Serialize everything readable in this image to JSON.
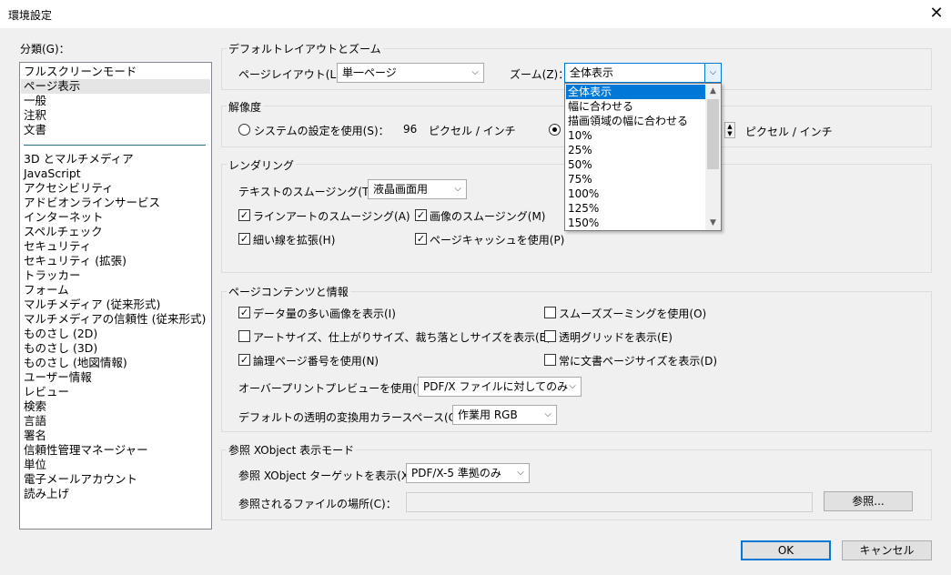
{
  "window": {
    "title": "環境設定",
    "close_glyph": "✕"
  },
  "categories": {
    "label": "分類(G)：",
    "items_top": [
      "フルスクリーンモード",
      "ページ表示",
      "一般",
      "注釈",
      "文書"
    ],
    "items_bottom": [
      "3D とマルチメディア",
      "JavaScript",
      "アクセシビリティ",
      "アドビオンラインサービス",
      "インターネット",
      "スペルチェック",
      "セキュリティ",
      "セキュリティ (拡張)",
      "トラッカー",
      "フォーム",
      "マルチメディア (従来形式)",
      "マルチメディアの信頼性 (従来形式)",
      "ものさし (2D)",
      "ものさし (3D)",
      "ものさし (地図情報)",
      "ユーザー情報",
      "レビュー",
      "検索",
      "言語",
      "署名",
      "信頼性管理マネージャー",
      "単位",
      "電子メールアカウント",
      "読み上げ"
    ],
    "selected": "ページ表示"
  },
  "layout_zoom": {
    "title": "デフォルトレイアウトとズーム",
    "page_layout_label": "ページレイアウト(L)：",
    "page_layout_value": "単一ページ",
    "zoom_label": "ズーム(Z)：",
    "zoom_value": "全体表示"
  },
  "zoom_dropdown": {
    "options": [
      "全体表示",
      "幅に合わせる",
      "描画領域の幅に合わせる",
      "10%",
      "25%",
      "50%",
      "75%",
      "100%",
      "125%",
      "150%"
    ],
    "selected": "全体表示"
  },
  "resolution": {
    "title": "解像度",
    "system_label": "システムの設定を使用(S)：",
    "system_value": "96",
    "unit_1": "ピクセル / インチ",
    "unit_2": "ピクセル / インチ"
  },
  "rendering": {
    "title": "レンダリング",
    "text_smoothing_label": "テキストのスムージング(T)：",
    "text_smoothing_value": "液晶画面用",
    "lineart_smoothing": "ラインアートのスムージング(A)",
    "image_smoothing": "画像のスムージング(M)",
    "enhance_thin_lines": "細い線を拡張(H)",
    "page_cache": "ページキャッシュを使用(P)"
  },
  "page_content": {
    "title": "ページコンテンツと情報",
    "large_images": "データ量の多い画像を表示(I)",
    "smooth_zooming": "スムーズズーミングを使用(O)",
    "art_trim_bleed": "アートサイズ、仕上がりサイズ、裁ち落としサイズを表示(B)",
    "transparency_grid": "透明グリッドを表示(E)",
    "logical_page_numbers": "論理ページ番号を使用(N)",
    "always_doc_page_size": "常に文書ページサイズを表示(D)",
    "overprint_label": "オーバープリントプレビューを使用(W)：",
    "overprint_value": "PDF/X ファイルに対してのみ",
    "transparency_blend_label": "デフォルトの透明の変換用カラースペース(C)：",
    "transparency_blend_value": "作業用 RGB"
  },
  "xobject": {
    "title": "参照 XObject 表示モード",
    "target_label": "参照 XObject ターゲットを表示(X)：",
    "target_value": "PDF/X-5 準拠のみ",
    "location_label": "参照されるファイルの場所(C)：",
    "browse_label": "参照..."
  },
  "footer": {
    "ok_label": "OK",
    "cancel_label": "キャンセル"
  },
  "glyphs": {
    "check": "✓",
    "chevron_down": "⌵",
    "arrow_up": "▲",
    "arrow_down": "▼"
  }
}
